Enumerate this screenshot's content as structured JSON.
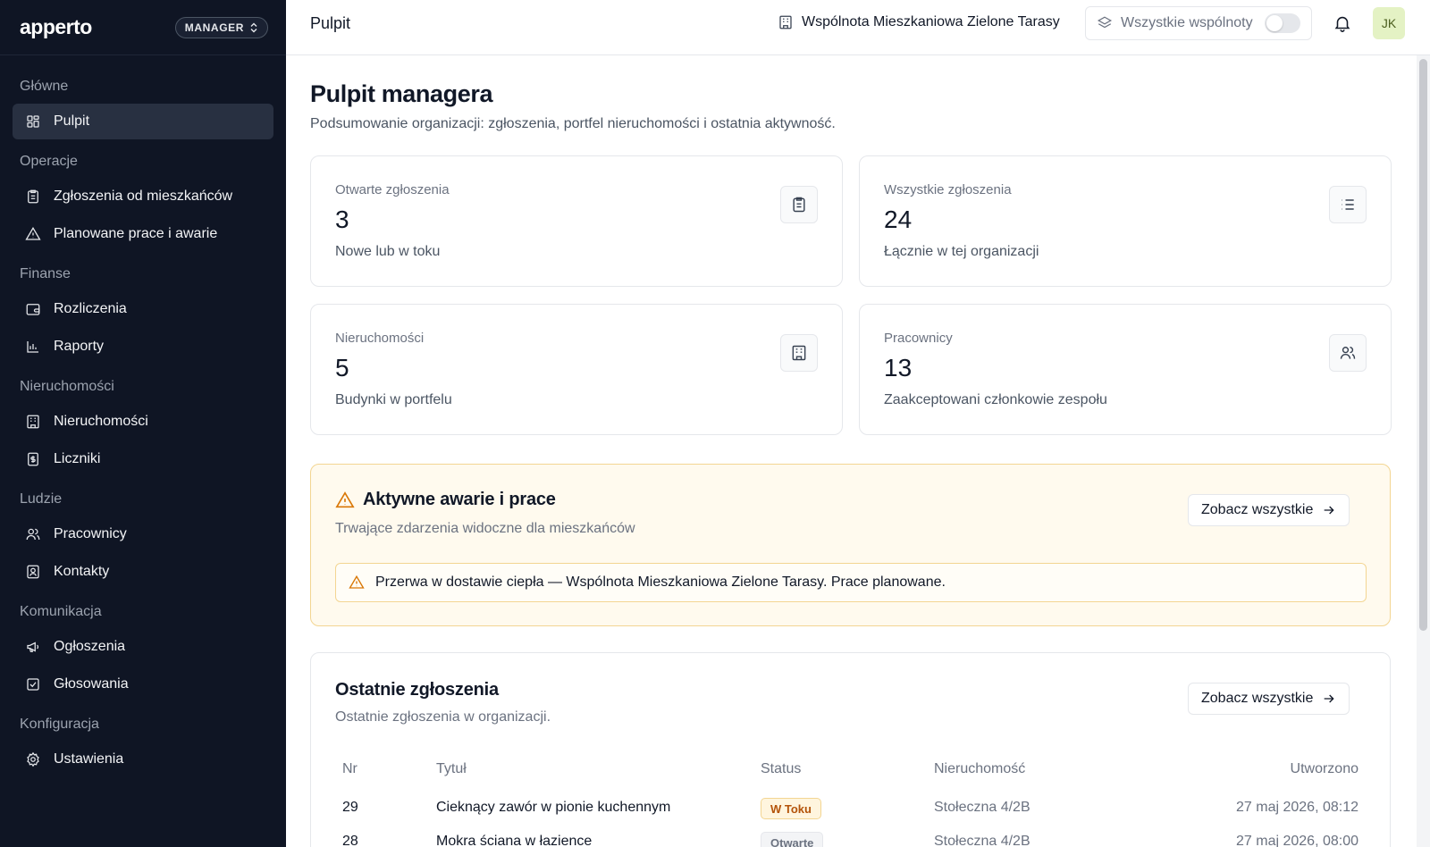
{
  "app": {
    "logo_text": "apperto",
    "role_label": "MANAGER"
  },
  "sidebar": {
    "sections": [
      {
        "title": "Główne",
        "items": [
          {
            "label": "Pulpit",
            "icon": "dashboard-icon",
            "active": true
          }
        ]
      },
      {
        "title": "Operacje",
        "items": [
          {
            "label": "Zgłoszenia od mieszkańców",
            "icon": "clipboard-icon"
          },
          {
            "label": "Planowane prace i awarie",
            "icon": "warning-icon"
          }
        ]
      },
      {
        "title": "Finanse",
        "items": [
          {
            "label": "Rozliczenia",
            "icon": "wallet-icon"
          },
          {
            "label": "Raporty",
            "icon": "bar-chart-icon"
          }
        ]
      },
      {
        "title": "Nieruchomości",
        "items": [
          {
            "label": "Nieruchomości",
            "icon": "building-icon"
          },
          {
            "label": "Liczniki",
            "icon": "meter-icon"
          }
        ]
      },
      {
        "title": "Ludzie",
        "items": [
          {
            "label": "Pracownicy",
            "icon": "users-icon"
          },
          {
            "label": "Kontakty",
            "icon": "contact-icon"
          }
        ]
      },
      {
        "title": "Komunikacja",
        "items": [
          {
            "label": "Ogłoszenia",
            "icon": "megaphone-icon"
          },
          {
            "label": "Głosowania",
            "icon": "vote-icon"
          }
        ]
      },
      {
        "title": "Konfiguracja",
        "items": [
          {
            "label": "Ustawienia",
            "icon": "settings-icon"
          }
        ]
      }
    ]
  },
  "topbar": {
    "title": "Pulpit",
    "organization": "Wspólnota Mieszkaniowa Zielone Tarasy",
    "all_communities_label": "Wszystkie wspólnoty",
    "all_communities_enabled": false,
    "avatar_initials": "JK"
  },
  "page": {
    "title": "Pulpit managera",
    "subtitle": "Podsumowanie organizacji: zgłoszenia, portfel nieruchomości i ostatnia aktywność."
  },
  "stats": [
    {
      "label": "Otwarte zgłoszenia",
      "value": "3",
      "sub": "Nowe lub w toku",
      "icon": "clipboard-icon"
    },
    {
      "label": "Wszystkie zgłoszenia",
      "value": "24",
      "sub": "Łącznie w tej organizacji",
      "icon": "list-icon"
    },
    {
      "label": "Nieruchomości",
      "value": "5",
      "sub": "Budynki w portfelu",
      "icon": "building-icon"
    },
    {
      "label": "Pracownicy",
      "value": "13",
      "sub": "Zaakceptowani członkowie zespołu",
      "icon": "users-icon"
    }
  ],
  "alerts": {
    "title": "Aktywne awarie i prace",
    "subtitle": "Trwające zdarzenia widoczne dla mieszkańców",
    "view_all_label": "Zobacz wszystkie",
    "items": [
      {
        "text": "Przerwa w dostawie ciepła — Wspólnota Mieszkaniowa Zielone Tarasy. Prace planowane."
      }
    ]
  },
  "recent": {
    "title": "Ostatnie zgłoszenia",
    "subtitle": "Ostatnie zgłoszenia w organizacji.",
    "view_all_label": "Zobacz wszystkie",
    "columns": {
      "nr": "Nr",
      "title": "Tytuł",
      "status": "Status",
      "property": "Nieruchomość",
      "created": "Utworzono"
    },
    "rows": [
      {
        "nr": "29",
        "title": "Cieknący zawór w pionie kuchennym",
        "status": "W Toku",
        "status_kind": "progress",
        "property": "Stołeczna 4/2B",
        "created": "27 maj 2026, 08:12"
      },
      {
        "nr": "28",
        "title": "Mokra ściana w łazience",
        "status": "Otwarte",
        "status_kind": "new",
        "property": "Stołeczna 4/2B",
        "created": "27 maj 2026, 08:00"
      }
    ]
  },
  "colors": {
    "sidebar_bg": "#0f1524",
    "accent_warning": "#d97706",
    "avatar_bg": "#e4f2c4"
  }
}
